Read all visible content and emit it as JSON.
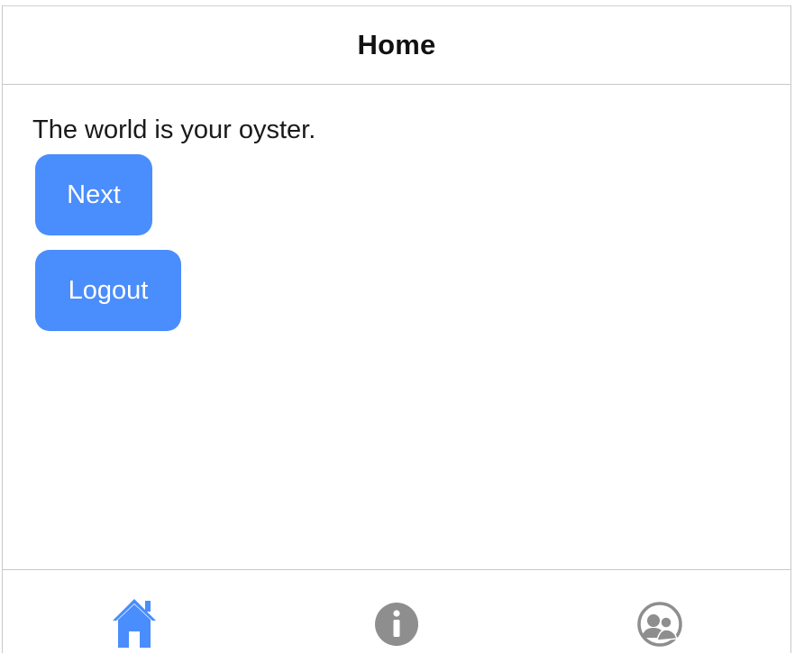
{
  "nav": {
    "title": "Home"
  },
  "content": {
    "message": "The world is your oyster.",
    "next_label": "Next",
    "logout_label": "Logout"
  },
  "tabs": [
    {
      "icon": "home-icon",
      "selected": true
    },
    {
      "icon": "info-icon",
      "selected": false
    },
    {
      "icon": "users-icon",
      "selected": false
    }
  ],
  "colors": {
    "accent": "#4a8dfc",
    "tab_inactive": "#8e8e8e",
    "text": "#1a1a1a"
  }
}
